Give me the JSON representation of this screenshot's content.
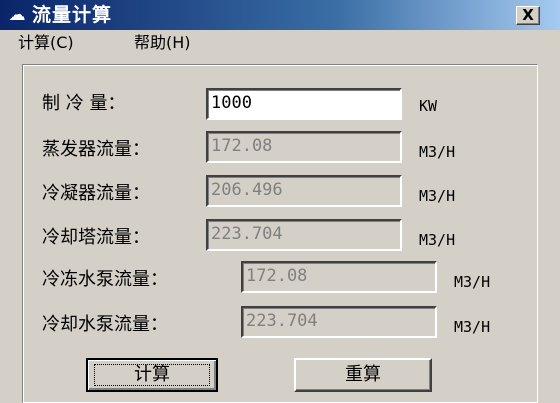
{
  "window": {
    "title": "流量计算",
    "close_label": "X"
  },
  "menu": [
    {
      "label": "计算(C)"
    },
    {
      "label": "帮助(H)"
    }
  ],
  "form": {
    "rows": [
      {
        "label": "制 冷 量：",
        "value": "1000",
        "unit": "KW",
        "editable": true
      },
      {
        "label": "蒸发器流量：",
        "value": "172.08",
        "unit": "M3/H",
        "editable": false
      },
      {
        "label": "冷凝器流量：",
        "value": "206.496",
        "unit": "M3/H",
        "editable": false
      },
      {
        "label": "冷却塔流量：",
        "value": "223.704",
        "unit": "M3/H",
        "editable": false
      },
      {
        "label": "冷冻水泵流量：",
        "value": "172.08",
        "unit": "M3/H",
        "editable": false
      },
      {
        "label": "冷却水泵流量：",
        "value": "223.704",
        "unit": "M3/H",
        "editable": false
      }
    ]
  },
  "buttons": {
    "calculate_label": "计算",
    "reset_label": "重算"
  }
}
